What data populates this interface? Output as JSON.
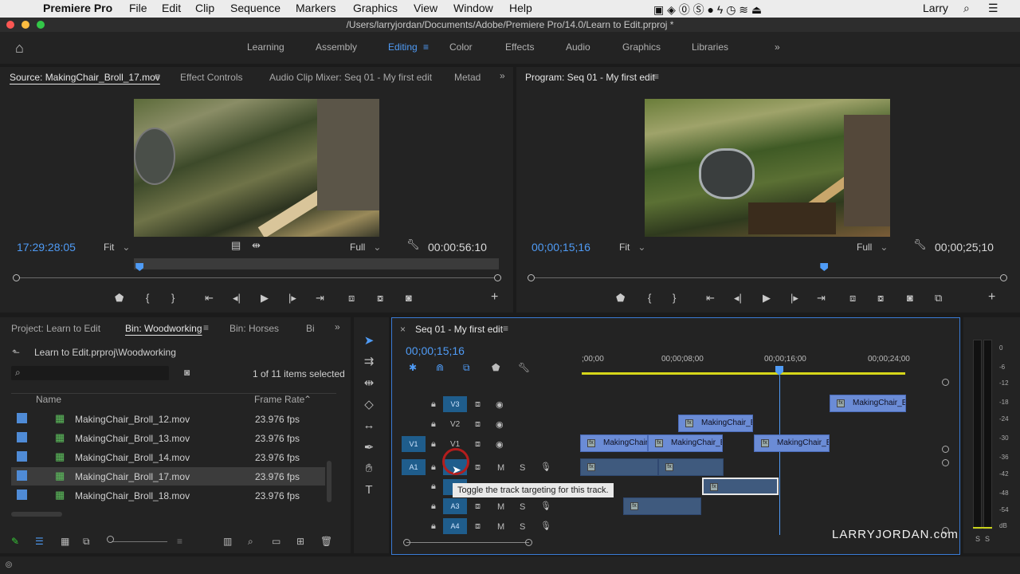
{
  "menubar": {
    "app": "Premiere Pro",
    "items": [
      "File",
      "Edit",
      "Clip",
      "Sequence",
      "Markers",
      "Graphics",
      "View",
      "Window",
      "Help"
    ],
    "user": "Larry"
  },
  "window": {
    "path": "/Users/larryjordan/Documents/Adobe/Premiere Pro/14.0/Learn to Edit.prproj *"
  },
  "workspaces": {
    "items": [
      "Learning",
      "Assembly",
      "Editing",
      "Color",
      "Effects",
      "Audio",
      "Graphics",
      "Libraries"
    ],
    "active": "Editing"
  },
  "source": {
    "tabs": [
      "Source: MakingChair_Broll_17.mov",
      "Effect Controls",
      "Audio Clip Mixer: Seq 01 - My first edit",
      "Metad"
    ],
    "timecode": "17:29:28:05",
    "fit": "Fit",
    "quality": "Full",
    "duration": "00:00:56:10",
    "playhead_fraction": 0.257
  },
  "program": {
    "title": "Program: Seq 01 - My first edit",
    "timecode": "00;00;15;16",
    "fit": "Fit",
    "quality": "Full",
    "duration": "00;00;25;10",
    "playhead_fraction": 0.618
  },
  "project": {
    "tabs": [
      "Project: Learn to Edit",
      "Bin: Woodworking",
      "Bin: Horses",
      "Bi"
    ],
    "path": "Learn to Edit.prproj\\Woodworking",
    "selection": "1 of 11 items selected",
    "columns": [
      "Name",
      "Frame Rate"
    ],
    "rows": [
      {
        "name": "MakingChair_Broll_12.mov",
        "fps": "23.976 fps"
      },
      {
        "name": "MakingChair_Broll_13.mov",
        "fps": "23.976 fps"
      },
      {
        "name": "MakingChair_Broll_14.mov",
        "fps": "23.976 fps"
      },
      {
        "name": "MakingChair_Broll_17.mov",
        "fps": "23.976 fps"
      },
      {
        "name": "MakingChair_Broll_18.mov",
        "fps": "23.976 fps"
      }
    ],
    "selected_index": 3
  },
  "timeline": {
    "title": "Seq 01 - My first edit",
    "timecode": "00;00;15;16",
    "ruler": [
      ";00;00",
      "00;00;08;00",
      "00;00;16;00",
      "00;00;24;00"
    ],
    "video_tracks": [
      "V3",
      "V2",
      "V1"
    ],
    "audio_tracks": [
      "A1",
      "A3",
      "A4"
    ],
    "source_patch": [
      "V1",
      "A1"
    ],
    "track_toggle_labels": {
      "mute": "M",
      "solo": "S"
    },
    "clip_label": "MakingChair_Br",
    "clip_label_b": "MakingChair_B",
    "clip_label_full": "MakingChair",
    "tooltip": "Toggle the track targeting for this track."
  },
  "meter": {
    "labels": [
      "0",
      "-6",
      "-12",
      "-18",
      "-24",
      "-30",
      "-36",
      "-42",
      "-48",
      "-54",
      "dB"
    ],
    "solo": [
      "S",
      "S"
    ]
  },
  "watermark": "LARRYJORDAN.com",
  "colors": {
    "accent": "#4f9bf5",
    "clip_video": "#6b8cd6",
    "clip_audio": "#3f5a7e",
    "track_target": "#1f5d8c"
  }
}
